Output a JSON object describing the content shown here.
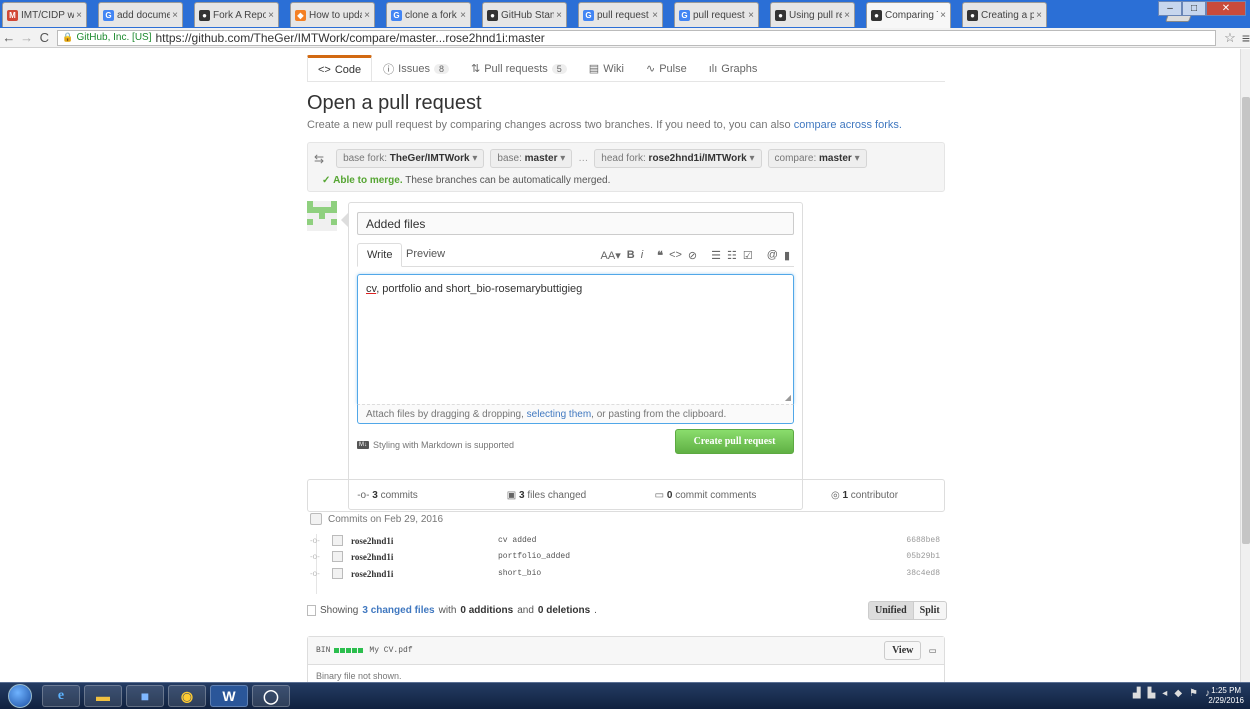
{
  "browser": {
    "tabs": [
      {
        "label": "IMT/CIDP work - ro",
        "icon": "M",
        "color": "#d14836"
      },
      {
        "label": "add documents to",
        "icon": "G",
        "color": "#4285f4"
      },
      {
        "label": "Fork A Repo - User",
        "icon": "●",
        "color": "#333333"
      },
      {
        "label": "How to update a Gi",
        "icon": "◆",
        "color": "#f48024"
      },
      {
        "label": "clone a fork - Goog",
        "icon": "G",
        "color": "#4285f4"
      },
      {
        "label": "GitHub Standard Fo",
        "icon": "●",
        "color": "#333333"
      },
      {
        "label": "pull request in git -",
        "icon": "G",
        "color": "#4285f4"
      },
      {
        "label": "pull request - Goog",
        "icon": "G",
        "color": "#4285f4"
      },
      {
        "label": "Using pull requests",
        "icon": "●",
        "color": "#333333"
      },
      {
        "label": "Comparing TheGer/",
        "icon": "●",
        "color": "#333333",
        "active": true
      },
      {
        "label": "Creating a pull requ",
        "icon": "●",
        "color": "#333333"
      }
    ],
    "ev_label": "GitHub, Inc. [US]",
    "url": "https://github.com/TheGer/IMTWork/compare/master...rose2hnd1i:master"
  },
  "reponav": {
    "code": "Code",
    "issues": "Issues",
    "issues_count": "8",
    "pulls": "Pull requests",
    "pulls_count": "5",
    "wiki": "Wiki",
    "pulse": "Pulse",
    "graphs": "Graphs"
  },
  "heading": {
    "title": "Open a pull request",
    "subtitle": "Create a new pull request by comparing changes across two branches. If you need to, you can also",
    "subtitle_link": "compare across forks."
  },
  "range": {
    "base_fork_label": "base fork:",
    "base_fork": "TheGer/IMTWork",
    "base_label": "base:",
    "base": "master",
    "head_fork_label": "head fork:",
    "head_fork": "rose2hnd1i/IMTWork",
    "compare_label": "compare:",
    "compare": "master",
    "merge_status": "Able to merge.",
    "merge_text": "These branches can be automatically merged."
  },
  "composer": {
    "title_value": "Added files",
    "write_tab": "Write",
    "preview_tab": "Preview",
    "body_word": "cv",
    "body_rest": ", portfolio and short_bio-rosemarybuttigieg",
    "attach_text_1": "Attach files by dragging & dropping,",
    "attach_link": "selecting them",
    "attach_text_2": ", or pasting from the clipboard.",
    "markdown_note": "Styling with Markdown is supported",
    "submit": "Create pull request"
  },
  "summary": {
    "commits_n": "3",
    "commits": "commits",
    "files_n": "3",
    "files": "files changed",
    "comments_n": "0",
    "comments": "commit comments",
    "contributors_n": "1",
    "contributors": "contributor"
  },
  "commits": {
    "header": "Commits on Feb 29, 2016",
    "rows": [
      {
        "author": "rose2hnd1i",
        "message": "cv added",
        "sha": "6688be8"
      },
      {
        "author": "rose2hnd1i",
        "message": "portfolio_added",
        "sha": "05b29b1"
      },
      {
        "author": "rose2hnd1i",
        "message": "short_bio",
        "sha": "38c4ed8"
      }
    ]
  },
  "files": {
    "showing": "Showing",
    "changed_link": "3 changed files",
    "with": "with",
    "additions": "0 additions",
    "and": "and",
    "deletions": "0 deletions",
    "unified": "Unified",
    "split": "Split",
    "bin": "BIN",
    "filename": "My CV.pdf",
    "view": "View",
    "note": "Binary file not shown."
  },
  "taskbar": {
    "time": "1:25 PM",
    "date": "2/29/2016"
  },
  "colors": {
    "accent": "#4078c0",
    "success": "#55a532",
    "tab_highlight": "#d26911"
  }
}
